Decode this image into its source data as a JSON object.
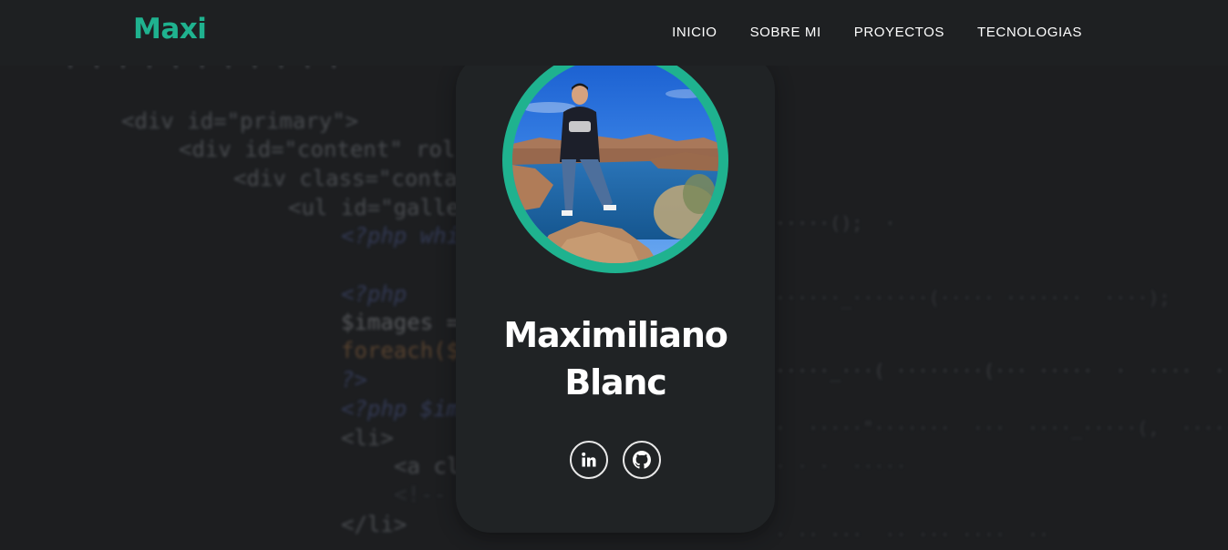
{
  "brand": {
    "logo_text": "Maxi",
    "accent_color": "#1fb28f"
  },
  "nav": {
    "items": [
      {
        "label": "INICIO"
      },
      {
        "label": "SOBRE MI"
      },
      {
        "label": "PROYECTOS"
      },
      {
        "label": "TECNOLOGIAS"
      }
    ]
  },
  "profile": {
    "name_line1": "Maximiliano",
    "name_line2": "Blanc",
    "avatar_icon": "profile-photo",
    "socials": [
      {
        "name": "linkedin",
        "label": "in"
      },
      {
        "name": "github",
        "icon": "github-icon"
      }
    ]
  },
  "background_code": {
    "lines": [
      "<div id=\"primary\">",
      "<div id=\"content\" rol",
      "<div class=\"conta",
      "<ul id=\"galle",
      "<?php whi",
      "<?php",
      "$images =",
      "foreach($",
      "?>",
      "<?php $im",
      "<li>",
      "<a cl",
      "<!-- ",
      "</li>"
    ]
  }
}
